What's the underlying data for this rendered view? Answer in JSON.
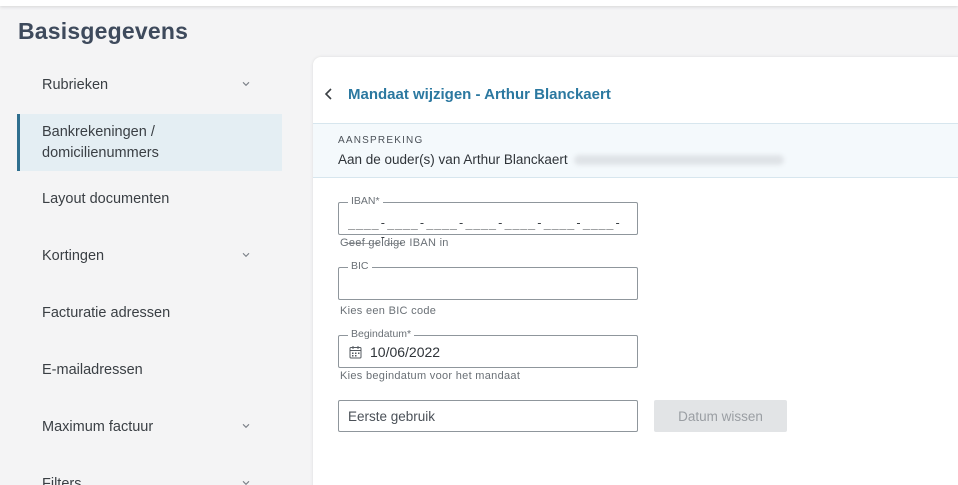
{
  "page": {
    "title": "Basisgegevens"
  },
  "sidebar": {
    "items": [
      {
        "label": "Rubrieken",
        "expandable": true
      },
      {
        "label": "Bankrekeningen / domicilienummers",
        "active": true
      },
      {
        "label": "Layout documenten"
      },
      {
        "label": "Kortingen",
        "expandable": true
      },
      {
        "label": "Facturatie adressen"
      },
      {
        "label": "E-mailadressen"
      },
      {
        "label": "Maximum factuur",
        "expandable": true
      },
      {
        "label": "Filters",
        "expandable": true
      }
    ]
  },
  "card": {
    "title": "Mandaat wijzigen - Arthur Blanckaert",
    "address": {
      "label": "AANSPREKING",
      "value": "Aan de ouder(s) van Arthur Blanckaert"
    }
  },
  "form": {
    "iban": {
      "label": "IBAN*",
      "mask": "____-____-____-____-____-____-____-____-__",
      "helper": "Geef geldige IBAN in"
    },
    "bic": {
      "label": "BIC",
      "helper": "Kies een BIC code"
    },
    "begindatum": {
      "label": "Begindatum*",
      "value": "10/06/2022",
      "helper": "Kies begindatum voor het mandaat"
    },
    "eerste_gebruik": {
      "placeholder": "Eerste gebruik"
    },
    "clear_button": "Datum wissen"
  },
  "colors": {
    "accent": "#2b78a0",
    "active_bg": "#e4eef3",
    "active_border": "#2f6f8f",
    "page_bg": "#f4f4f5"
  }
}
